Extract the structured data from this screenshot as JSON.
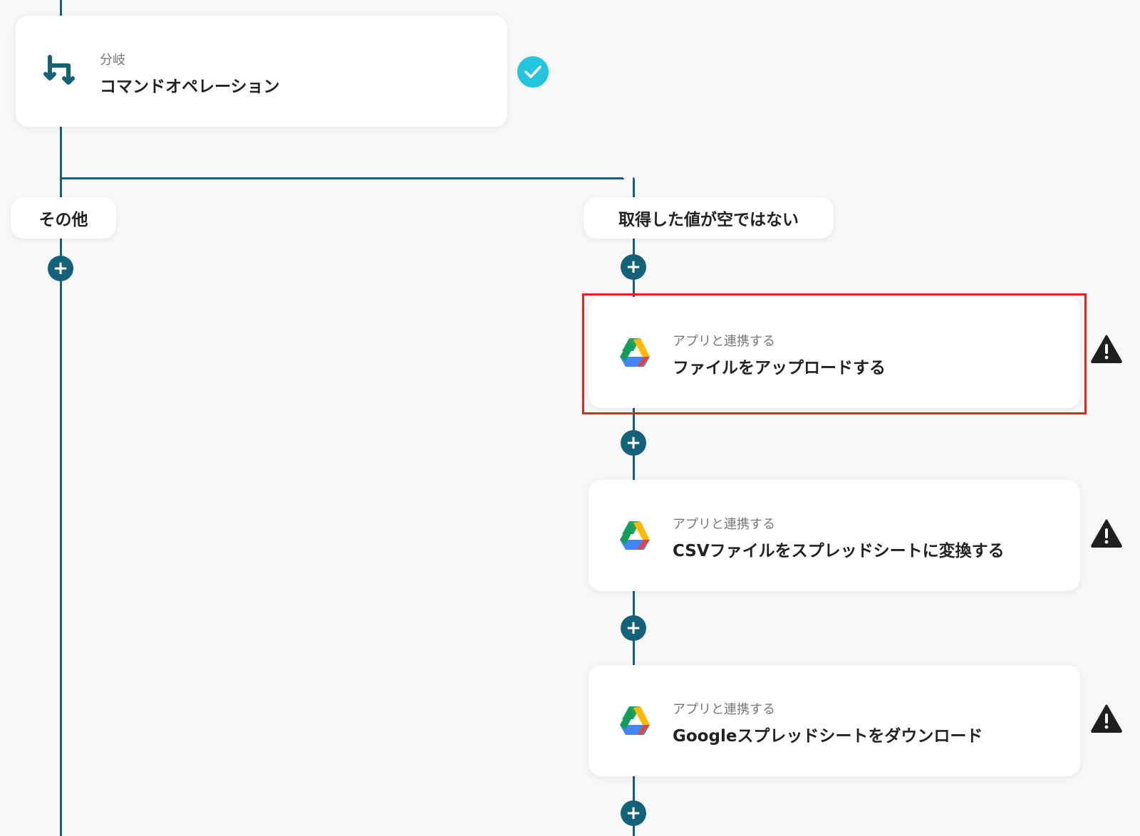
{
  "branch_node": {
    "sub_label": "分岐",
    "title": "コマンドオペレーション",
    "icon": "branch-icon",
    "status_icon": "check-icon",
    "status_color": "#22c5dd"
  },
  "branches": {
    "left": {
      "label": "その他"
    },
    "right": {
      "label": "取得した値が空ではない"
    }
  },
  "steps": [
    {
      "sub_label": "アプリと連携する",
      "title": "ファイルをアップロードする",
      "app_icon": "google-drive-icon",
      "status_icon": "warning-icon",
      "highlighted": true
    },
    {
      "sub_label": "アプリと連携する",
      "title": "CSVファイルをスプレッドシートに変換する",
      "app_icon": "google-drive-icon",
      "status_icon": "warning-icon",
      "highlighted": false
    },
    {
      "sub_label": "アプリと連携する",
      "title": "Googleスプレッドシートをダウンロード",
      "app_icon": "google-drive-icon",
      "status_icon": "warning-icon",
      "highlighted": false
    }
  ],
  "add_button_label": "+",
  "colors": {
    "line": "#14627a",
    "highlight": "#e8231c",
    "background": "#f8f8f8"
  }
}
